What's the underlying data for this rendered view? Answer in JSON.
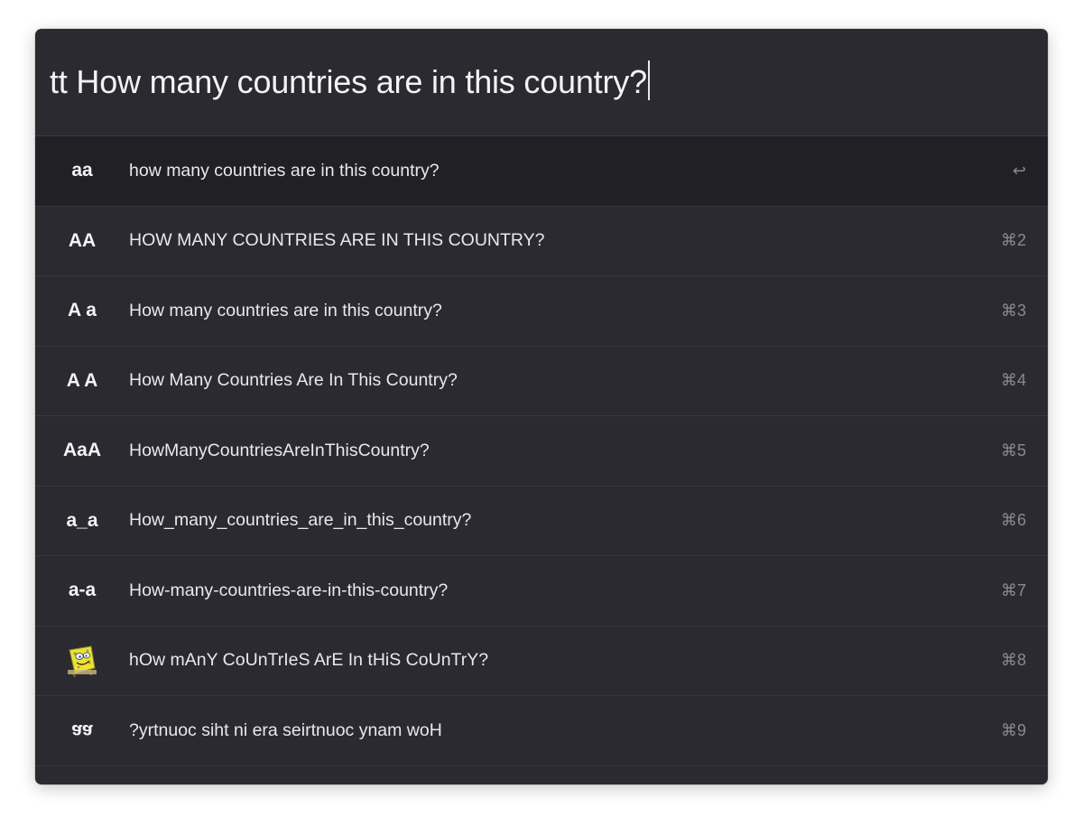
{
  "search": {
    "value": "tt How many countries are in this country?"
  },
  "results": [
    {
      "icon": "aa",
      "label": "how many countries are in this country?",
      "shortcut": "↩"
    },
    {
      "icon": "AA",
      "label": "HOW MANY COUNTRIES ARE IN THIS COUNTRY?",
      "shortcut": "⌘2"
    },
    {
      "icon": "A a",
      "label": "How many countries are in this country?",
      "shortcut": "⌘3"
    },
    {
      "icon": "A A",
      "label": "How Many Countries Are In This Country?",
      "shortcut": "⌘4"
    },
    {
      "icon": "AaA",
      "label": "HowManyCountriesAreInThisCountry?",
      "shortcut": "⌘5"
    },
    {
      "icon": "a_a",
      "label": "How_many_countries_are_in_this_country?",
      "shortcut": "⌘6"
    },
    {
      "icon": "a-a",
      "label": "How-many-countries-are-in-this-country?",
      "shortcut": "⌘7"
    },
    {
      "icon": "spongebob-mocking-icon",
      "label": "hOw mAnY CoUnTrIeS ArE In tHiS CoUnTrY?",
      "shortcut": "⌘8"
    },
    {
      "icon": "aa",
      "label": "?yrtnuoc siht ni era seirtnuoc ynam woH",
      "shortcut": "⌘9"
    }
  ],
  "colors": {
    "window_bg": "#2b2a30",
    "selected_row_bg": "#212025",
    "text": "#e9e9ec",
    "shortcut_text": "#8a8990"
  }
}
